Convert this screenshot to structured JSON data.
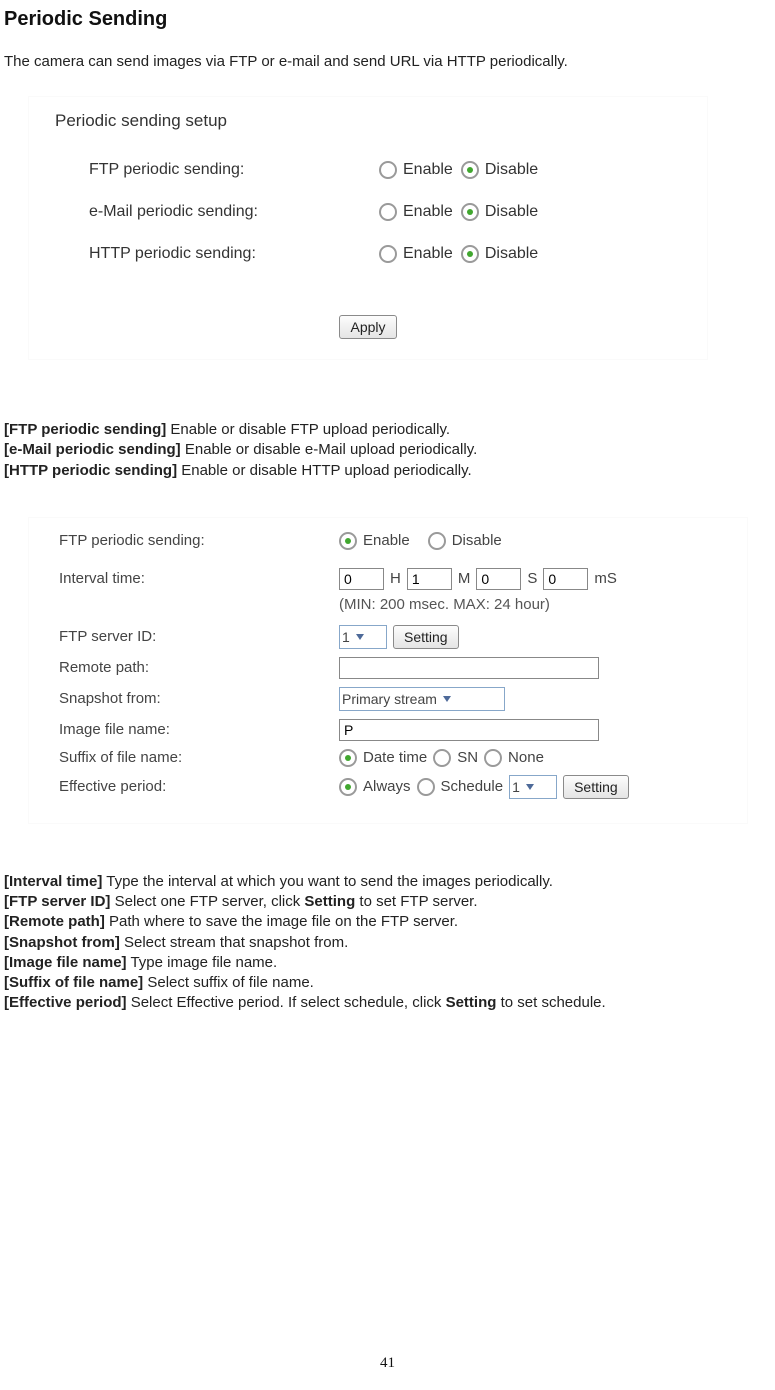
{
  "title": "Periodic Sending",
  "intro": "The camera can send images via FTP or e-mail and send URL via HTTP periodically.",
  "fig1": {
    "heading": "Periodic sending setup",
    "rows": [
      {
        "label": "FTP periodic sending:",
        "enable": "Enable",
        "disable": "Disable"
      },
      {
        "label": "e-Mail periodic sending:",
        "enable": "Enable",
        "disable": "Disable"
      },
      {
        "label": "HTTP periodic sending:",
        "enable": "Enable",
        "disable": "Disable"
      }
    ],
    "apply": "Apply"
  },
  "desc1": [
    {
      "key": "[FTP periodic sending]",
      "text": " Enable or disable FTP upload periodically."
    },
    {
      "key": "[e-Mail periodic sending]",
      "text": " Enable or disable e-Mail upload periodically."
    },
    {
      "key": "[HTTP periodic sending]",
      "text": " Enable or disable HTTP upload periodically."
    }
  ],
  "fig2": {
    "header": {
      "label": "FTP periodic sending:",
      "enable": "Enable",
      "disable": "Disable"
    },
    "interval": {
      "label": "Interval time:",
      "h": "0",
      "h_unit": "H",
      "m": "1",
      "m_unit": "M",
      "s": "0",
      "s_unit": "S",
      "ms": "0",
      "ms_unit": "mS"
    },
    "hint": "(MIN: 200 msec. MAX: 24 hour)",
    "server": {
      "label": "FTP server ID:",
      "value": "1",
      "btn": "Setting"
    },
    "remote": {
      "label": "Remote path:",
      "value": ""
    },
    "snapshot": {
      "label": "Snapshot from:",
      "value": "Primary stream"
    },
    "imgname": {
      "label": "Image file name:",
      "value": "P"
    },
    "suffix": {
      "label": "Suffix of file name:",
      "opt1": "Date time",
      "opt2": "SN",
      "opt3": "None"
    },
    "effective": {
      "label": "Effective period:",
      "opt1": "Always",
      "opt2": "Schedule",
      "sel": "1",
      "btn": "Setting"
    }
  },
  "desc2": [
    {
      "key": "[Interval time]",
      "text": " Type the interval at which you want to send the images periodically."
    },
    {
      "key": "[FTP server ID]",
      "pre": " Select one FTP server, click ",
      "bold": "Setting",
      "post": " to set FTP server."
    },
    {
      "key": "[Remote path]",
      "text": " Path where to save the image file on the FTP server."
    },
    {
      "key": "[Snapshot from]",
      "text": " Select stream that snapshot from."
    },
    {
      "key": "[Image file name]",
      "text": " Type image file name."
    },
    {
      "key": "[Suffix of file name]",
      "text": " Select suffix of file name."
    },
    {
      "key": "[Effective period]",
      "pre": " Select Effective period. If select   schedule, click ",
      "bold": "Setting",
      "post": " to set schedule."
    }
  ],
  "page_number": "41"
}
